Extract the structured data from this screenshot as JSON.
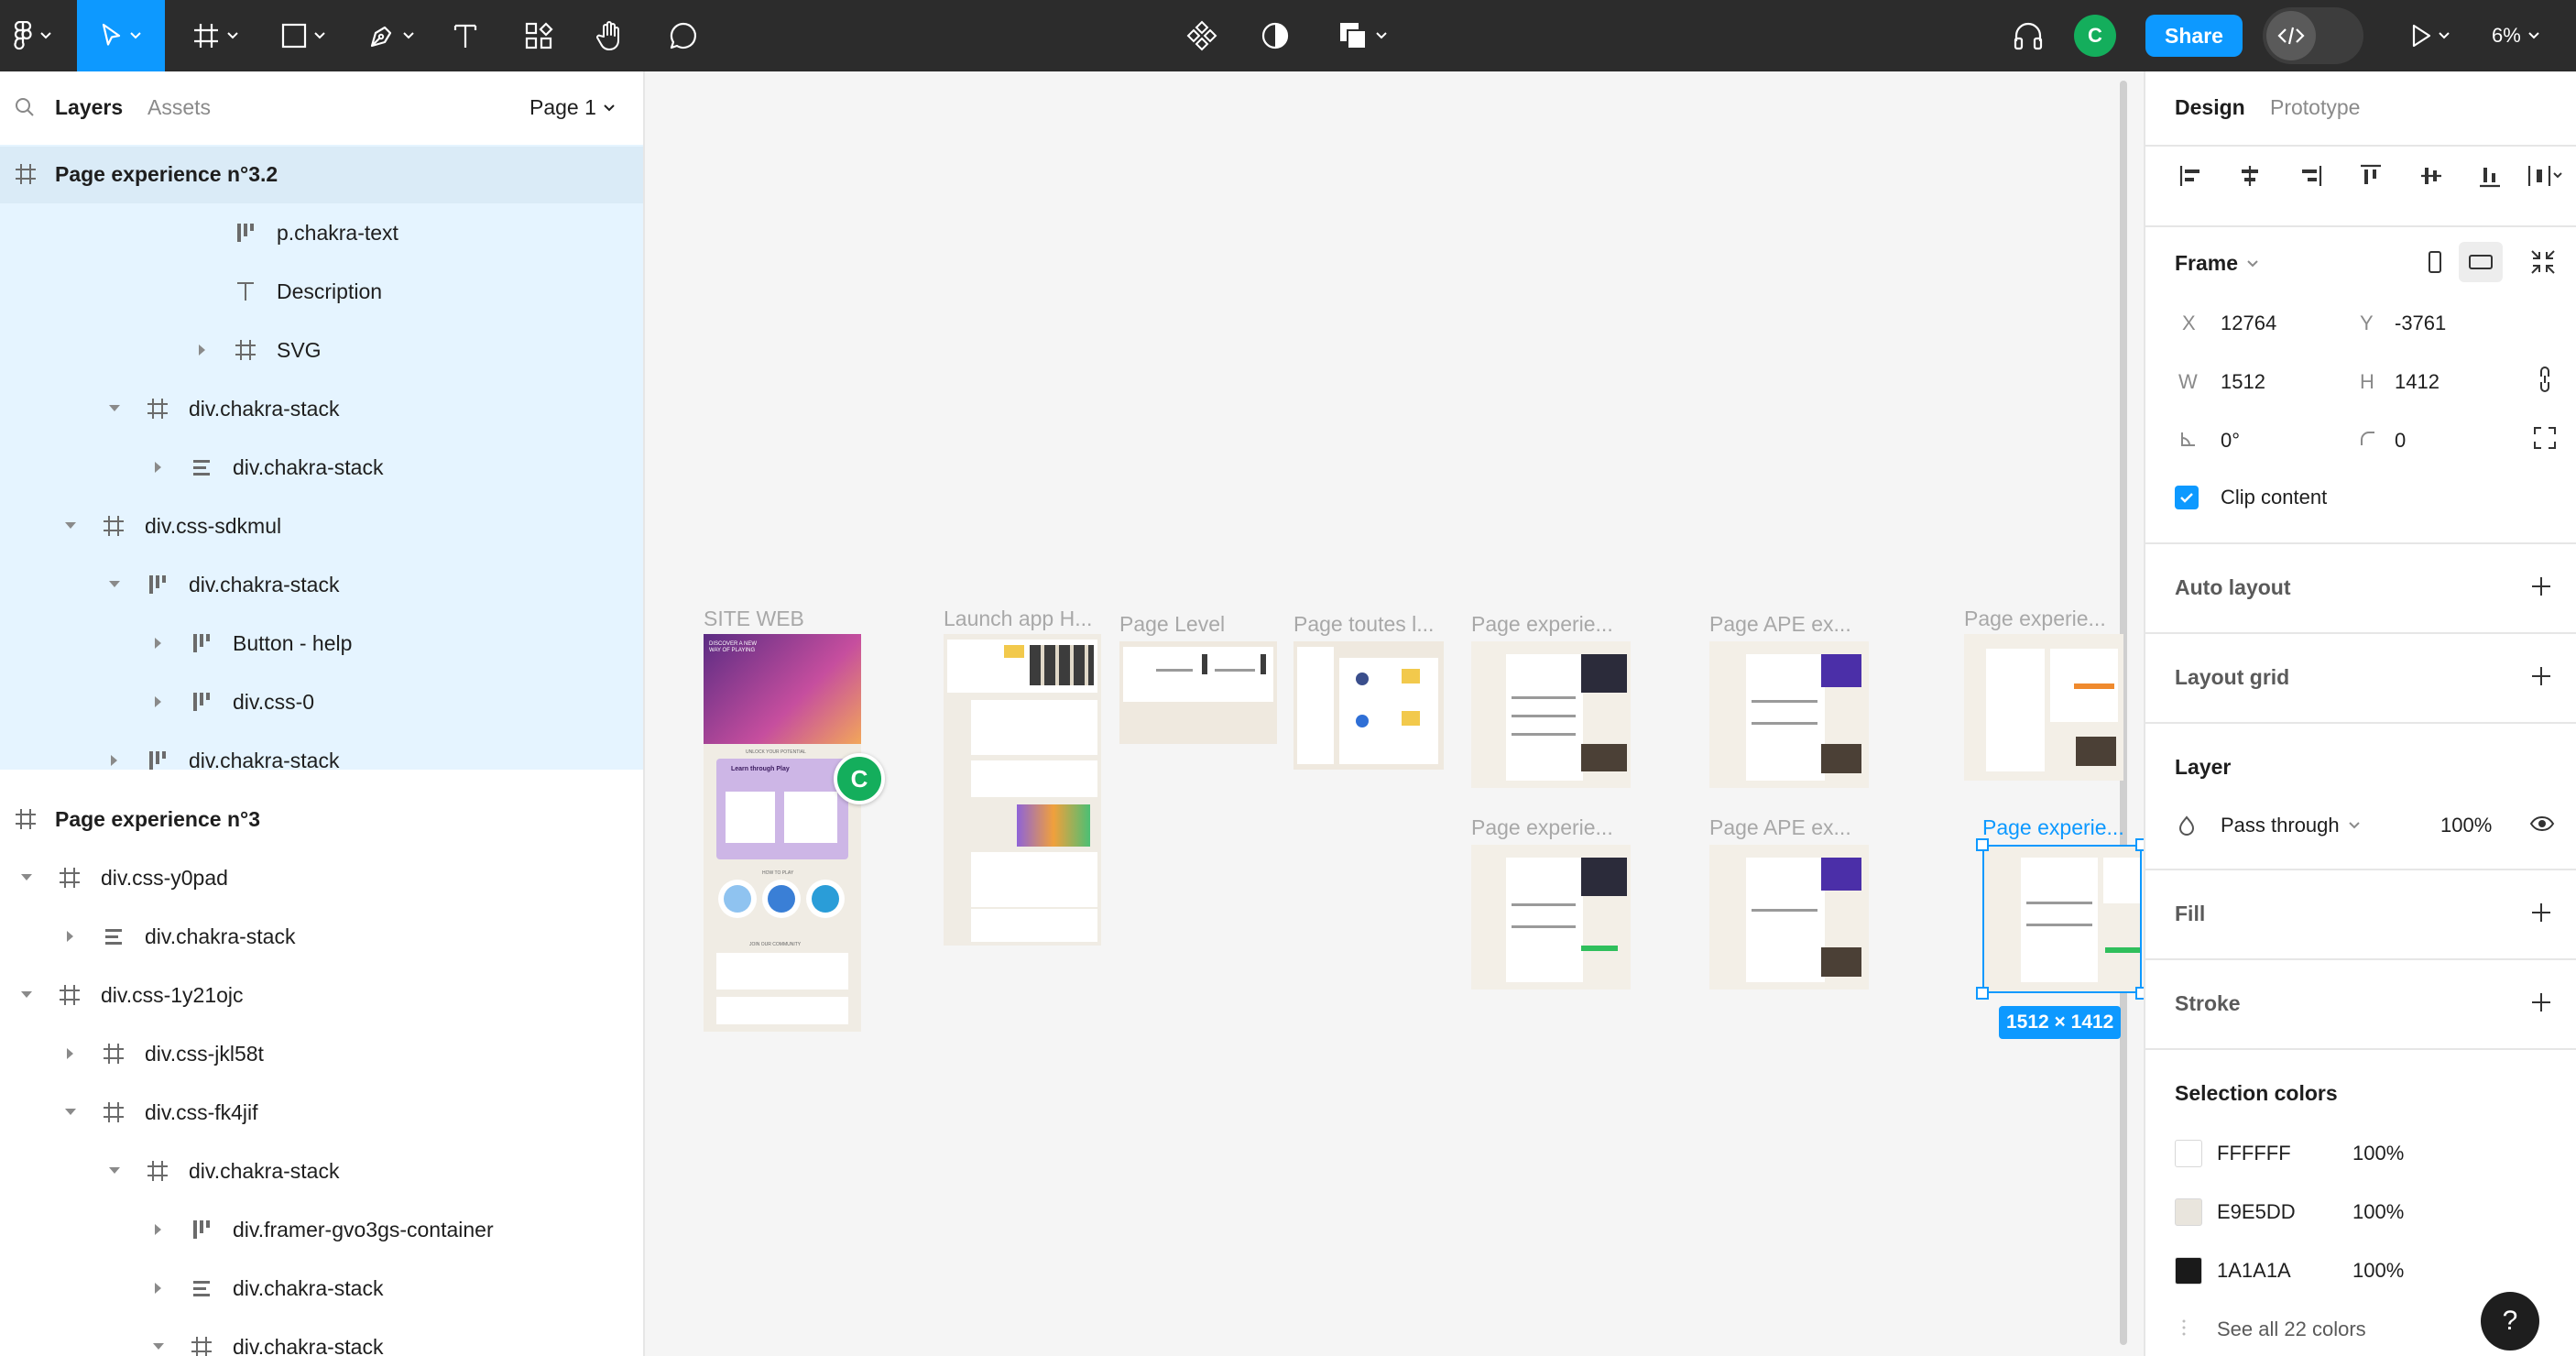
{
  "toolbar": {
    "share_label": "Share",
    "avatar_initial": "C",
    "zoom_label": "6%"
  },
  "left_panel": {
    "tabs": [
      "Layers",
      "Assets"
    ],
    "page_selector": "Page 1",
    "layers": [
      {
        "label": "Page experience n°3.2",
        "icon": "frame-icon",
        "top_level": true,
        "selected_header": true
      },
      {
        "label": "p.chakra-text",
        "icon": "autolayout-vertical-icon"
      },
      {
        "label": "Description",
        "icon": "text-icon"
      },
      {
        "label": "SVG",
        "icon": "frame-icon",
        "arrow": "right"
      },
      {
        "label": "div.chakra-stack",
        "icon": "frame-icon",
        "arrow": "down"
      },
      {
        "label": "div.chakra-stack",
        "icon": "autolayout-horizontal-icon",
        "arrow": "right"
      },
      {
        "label": "div.css-sdkmul",
        "icon": "frame-icon",
        "arrow": "down"
      },
      {
        "label": "div.chakra-stack",
        "icon": "autolayout-vertical-icon",
        "arrow": "down"
      },
      {
        "label": "Button - help",
        "icon": "autolayout-vertical-icon",
        "arrow": "right"
      },
      {
        "label": "div.css-0",
        "icon": "autolayout-vertical-icon",
        "arrow": "right"
      },
      {
        "label": "div.chakra-stack",
        "icon": "autolayout-vertical-icon",
        "arrow": "right"
      },
      {
        "label": "Page experience n°3",
        "icon": "frame-icon",
        "top_level": true
      },
      {
        "label": "div.css-y0pad",
        "icon": "frame-icon",
        "arrow": "down"
      },
      {
        "label": "div.chakra-stack",
        "icon": "autolayout-horizontal-icon",
        "arrow": "right"
      },
      {
        "label": "div.css-1y21ojc",
        "icon": "frame-icon",
        "arrow": "down"
      },
      {
        "label": "div.css-jkl58t",
        "icon": "frame-icon",
        "arrow": "right"
      },
      {
        "label": "div.css-fk4jif",
        "icon": "frame-icon",
        "arrow": "down"
      },
      {
        "label": "div.chakra-stack",
        "icon": "frame-icon",
        "arrow": "down"
      },
      {
        "label": "div.framer-gvo3gs-container",
        "icon": "autolayout-vertical-icon",
        "arrow": "right"
      },
      {
        "label": "div.chakra-stack",
        "icon": "autolayout-horizontal-icon",
        "arrow": "right"
      },
      {
        "label": "div.chakra-stack",
        "icon": "frame-icon",
        "arrow": "down"
      }
    ]
  },
  "canvas": {
    "frames": [
      {
        "title": "SITE WEB"
      },
      {
        "title": "Launch app H..."
      },
      {
        "title": "Page Level"
      },
      {
        "title": "Page toutes l..."
      },
      {
        "title": "Page experie..."
      },
      {
        "title": "Page APE ex..."
      },
      {
        "title": "Page experie..."
      },
      {
        "title": "Page experie..."
      },
      {
        "title": "Page APE ex..."
      },
      {
        "title": "Page experie..."
      }
    ],
    "thumb_texts": {
      "hero_heading": "DISCOVER A NEW WAY OF PLAYING",
      "learn_card": "Learn through Play",
      "unlock": "UNLOCK YOUR POTENTIAL",
      "how_to_play": "HOW TO PLAY",
      "community": "JOIN OUR COMMUNITY"
    },
    "cursor_initial": "C",
    "selection_dimensions": "1512 × 1412"
  },
  "right_panel": {
    "tabs": [
      "Design",
      "Prototype"
    ],
    "frame_label": "Frame",
    "x_label": "X",
    "x_value": "12764",
    "y_label": "Y",
    "y_value": "-3761",
    "w_label": "W",
    "w_value": "1512",
    "h_label": "H",
    "h_value": "1412",
    "rotation_value": "0°",
    "radius_value": "0",
    "clip_content_label": "Clip content",
    "clip_content_checked": true,
    "auto_layout_label": "Auto layout",
    "layout_grid_label": "Layout grid",
    "layer_label": "Layer",
    "blend_mode": "Pass through",
    "layer_opacity": "100%",
    "fill_label": "Fill",
    "stroke_label": "Stroke",
    "selection_colors_label": "Selection colors",
    "selection_colors": [
      {
        "hex": "FFFFFF",
        "opacity": "100%",
        "color": "#FFFFFF"
      },
      {
        "hex": "E9E5DD",
        "opacity": "100%",
        "color": "#E9E5DD"
      },
      {
        "hex": "1A1A1A",
        "opacity": "100%",
        "color": "#1A1A1A"
      }
    ],
    "see_all_colors": "See all 22 colors",
    "help_label": "?"
  },
  "colors": {
    "accent": "#0d99ff",
    "toolbar_bg": "#2c2c2c",
    "avatar": "#14ae5c",
    "selection_bg": "#e5f4ff"
  }
}
